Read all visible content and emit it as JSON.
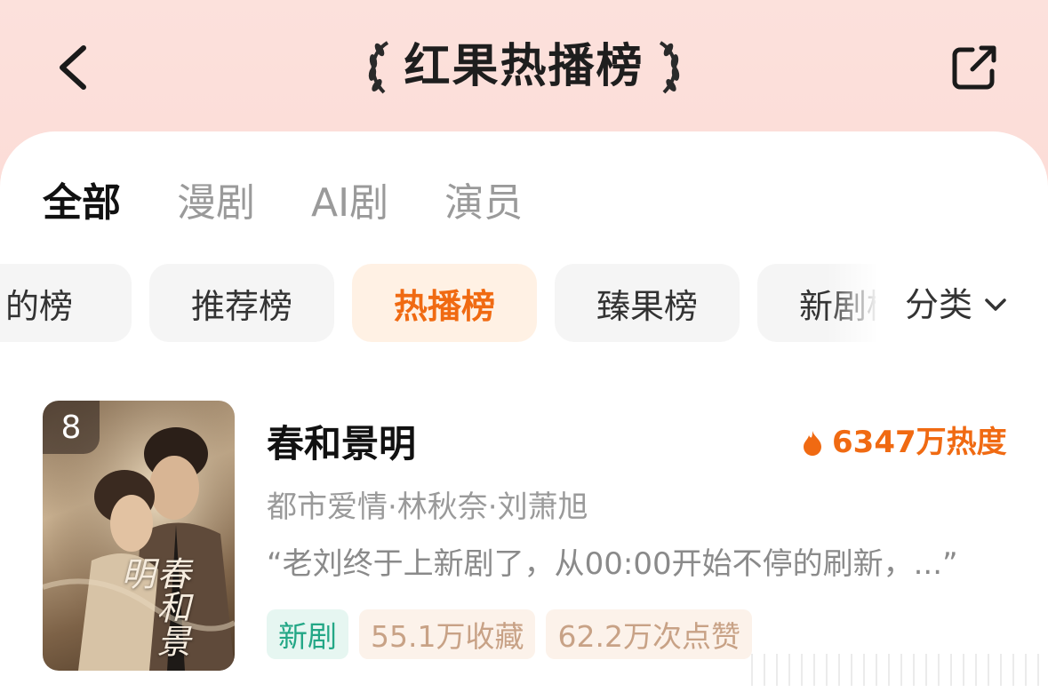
{
  "header": {
    "title": "红果热播榜",
    "back_icon": "chevron-left-icon",
    "share_icon": "share-icon"
  },
  "tabs": [
    {
      "label": "全部",
      "active": true
    },
    {
      "label": "漫剧",
      "active": false
    },
    {
      "label": "AI剧",
      "active": false
    },
    {
      "label": "演员",
      "active": false
    }
  ],
  "chips": [
    {
      "label": "的榜",
      "active": false
    },
    {
      "label": "推荐榜",
      "active": false
    },
    {
      "label": "热播榜",
      "active": true
    },
    {
      "label": "臻果榜",
      "active": false
    },
    {
      "label": "新剧榜",
      "active": false
    }
  ],
  "category": {
    "label": "分类",
    "icon": "chevron-down-icon"
  },
  "item": {
    "rank": "8",
    "poster_title": "春和景明",
    "title": "春和景明",
    "heat": "6347万热度",
    "meta": "都市爱情·林秋奈·刘萧旭",
    "quote": "“老刘终于上新剧了，从00:00开始不停的刷新，...”",
    "tags": [
      {
        "label": "新剧",
        "style": "green"
      },
      {
        "label": "55.1万收藏",
        "style": "tan"
      },
      {
        "label": "62.2万次点赞",
        "style": "tan"
      }
    ]
  },
  "colors": {
    "accent": "#f06a12",
    "green_tag": "#23a786",
    "header_bg": "#fce1dc"
  }
}
